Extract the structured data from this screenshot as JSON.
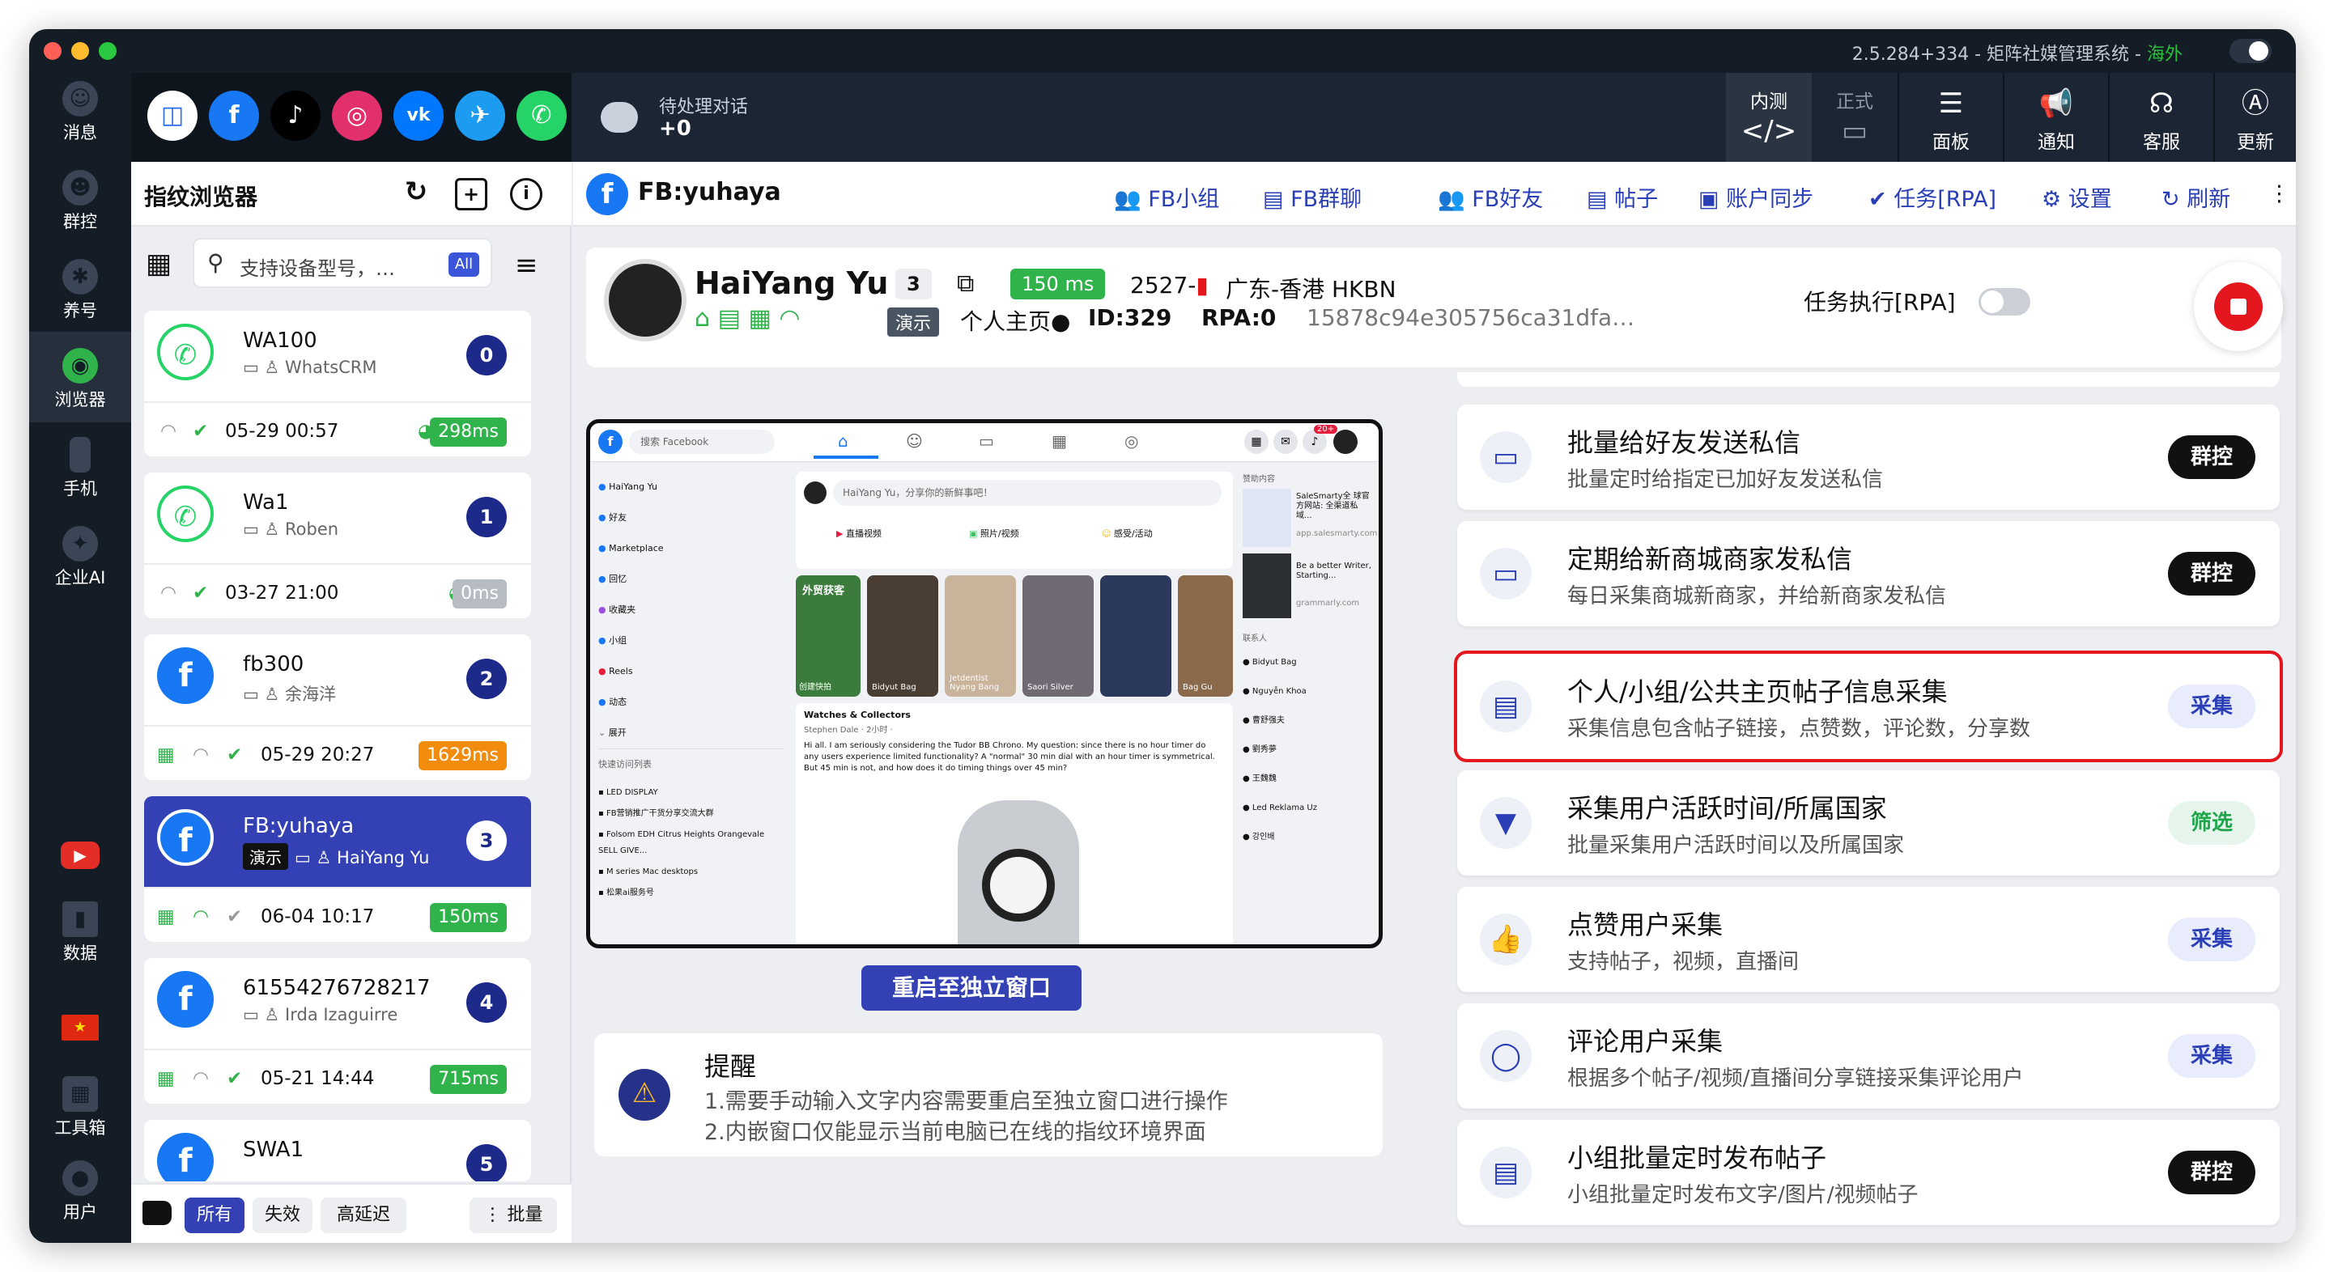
{
  "window": {
    "title": "2.5.284+334 - 矩阵社媒管理系统 -",
    "region": "海外"
  },
  "nav": [
    {
      "label": "消息",
      "icon": "message-icon"
    },
    {
      "label": "群控",
      "icon": "group-control-icon"
    },
    {
      "label": "养号",
      "icon": "nurture-icon"
    },
    {
      "label": "浏览器",
      "icon": "browser-icon"
    },
    {
      "label": "手机",
      "icon": "phone-icon"
    },
    {
      "label": "企业AI",
      "icon": "ai-icon"
    },
    {
      "label": "",
      "icon": "youtube-icon"
    },
    {
      "label": "数据",
      "icon": "data-icon"
    },
    {
      "label": "",
      "icon": "flag-china-icon"
    },
    {
      "label": "工具箱",
      "icon": "toolbox-icon"
    },
    {
      "label": "用户",
      "icon": "user-icon"
    }
  ],
  "apps": [
    "generic-app-icon",
    "facebook-icon",
    "tiktok-icon",
    "instagram-icon",
    "vk-icon",
    "twitter-icon",
    "whatsapp-icon"
  ],
  "pending": {
    "label": "待处理对话",
    "value": "+0"
  },
  "top_buttons": [
    {
      "top": "内测",
      "label": "</>"
    },
    {
      "top": "正式",
      "label": ""
    },
    {
      "label": "面板"
    },
    {
      "label": "通知"
    },
    {
      "label": "客服"
    },
    {
      "label": "更新"
    }
  ],
  "fp": {
    "title": "指纹浏览器",
    "search_placeholder": "支持设备型号，…",
    "all": "All",
    "cards": [
      {
        "name": "WA100",
        "sub": "WhatsCRM",
        "num": "0",
        "date": "05-29 00:57",
        "ms": "298ms",
        "ms_color": "#2fb34a"
      },
      {
        "name": "Wa1",
        "sub": "Roben",
        "num": "1",
        "date": "03-27 21:00",
        "ms": "0ms",
        "ms_color": "#b7bcc4"
      },
      {
        "name": "fb300",
        "sub": "余海洋",
        "num": "2",
        "date": "05-29 20:27",
        "ms": "1629ms",
        "ms_color": "#f28c0f"
      },
      {
        "name": "FB:yuhaya",
        "demo": "演示",
        "sub": "HaiYang Yu",
        "num": "3",
        "date": "06-04 10:17",
        "ms": "150ms",
        "ms_color": "#2fb34a"
      },
      {
        "name": "61554276728217",
        "sub": "Irda Izaguirre",
        "num": "4",
        "date": "05-21 14:44",
        "ms": "715ms",
        "ms_color": "#2fb34a"
      },
      {
        "name": "SWA1",
        "num": "5"
      }
    ],
    "filters": [
      "所有",
      "失效",
      "高延迟"
    ],
    "batch": "批量"
  },
  "main": {
    "title": "FB:yuhaya",
    "links": [
      "FB小组",
      "FB群聊",
      "FB好友",
      "帖子",
      "账户同步",
      "任务[RPA]",
      "设置",
      "刷新"
    ],
    "profile": {
      "name": "HaiYang Yu",
      "count": "3",
      "ms": "150 ms",
      "code": "2527-",
      "location": "广东-香港 HKBN",
      "demo": "演示",
      "home": "个人主页●",
      "id": "ID:329",
      "rpa": "RPA:0",
      "hash": "15878c94e305756ca31dfa…",
      "task_label": "任务执行[RPA]"
    },
    "restart": "重启至独立窗口",
    "remind": {
      "title": "提醒",
      "l1": "1.需要手动输入文字内容需要重启至独立窗口进行操作",
      "l2": "2.内嵌窗口仅能显示当前电脑已在线的指纹环境界面"
    },
    "tasks": [
      {
        "title": "批量给好友发送私信",
        "desc": "批量定时给指定已加好友发送私信",
        "btn": "群控",
        "style": "dark",
        "icon": "chat-icon"
      },
      {
        "title": "定期给新商城商家发私信",
        "desc": "每日采集商城新商家，并给新商家发私信",
        "btn": "群控",
        "style": "dark",
        "icon": "chat-icon"
      },
      {
        "title": "个人/小组/公共主页帖子信息采集",
        "desc": "采集信息包含帖子链接，点赞数，评论数，分享数",
        "btn": "采集",
        "style": "blue",
        "icon": "post-icon"
      },
      {
        "title": "采集用户活跃时间/所属国家",
        "desc": "批量采集用户活跃时间以及所属国家",
        "btn": "筛选",
        "style": "green",
        "icon": "filter-icon"
      },
      {
        "title": "点赞用户采集",
        "desc": "支持帖子，视频，直播间",
        "btn": "采集",
        "style": "blue",
        "icon": "like-icon"
      },
      {
        "title": "评论用户采集",
        "desc": "根据多个帖子/视频/直播间分享链接采集评论用户",
        "btn": "采集",
        "style": "blue",
        "icon": "comment-icon"
      },
      {
        "title": "小组批量定时发布帖子",
        "desc": "小组批量定时发布文字/图片/视频帖子",
        "btn": "群控",
        "style": "dark",
        "icon": "post-icon"
      }
    ]
  },
  "fb": {
    "search": "搜索 Facebook",
    "composer": "HaiYang Yu，分享你的新鲜事吧！",
    "composer_actions": [
      "直播视频",
      "照片/视频",
      "感受/活动"
    ],
    "menu": [
      "HaiYang Yu",
      "好友",
      "Marketplace",
      "回忆",
      "收藏夹",
      "小组",
      "Reels",
      "动态",
      "展开"
    ],
    "shortcuts_title": "快速访问列表",
    "shortcuts": [
      "LED DISPLAY",
      "FB营销推广干货分享交流大群",
      "Folsom EDH Citrus Heights Orangevale SELL GIVE...",
      "M series Mac desktops",
      "松果ai服务号"
    ],
    "stories": [
      "创建快拍",
      "外贸获客",
      "Bidyut Bag",
      "Jetdentist Nyang Bang",
      "Saori Silver",
      "",
      "Bag Gu"
    ],
    "post_group": "Watches & Collectors",
    "post_author": "Stephen Dale · 2小时 ·",
    "post_text": "Hi all.  I am seriously considering the Tudor BB Chrono. My question: since there is no hour timer do any users experience limited functionality? A \"normal\" 30 min dial with an hour timer is symmetrical. But 45 min is not, and how does it do timing things over 45 min?",
    "sponsored": "赞助内容",
    "ad1": "SaleSmarty全 球官方网站: 全渠道私域...",
    "ad1_domain": "app.salesmarty.com",
    "ad2": "Be a better Writer, Starting...",
    "ad2_domain": "grammarly.com",
    "contacts_title": "联系人",
    "contacts": [
      "Bidyut Bag",
      "Nguyễn Khoa",
      "曹舒强夫",
      "劉秀夢",
      "王魏魏",
      "Led Reklama Uz",
      "강인배"
    ],
    "badge": "20+"
  }
}
